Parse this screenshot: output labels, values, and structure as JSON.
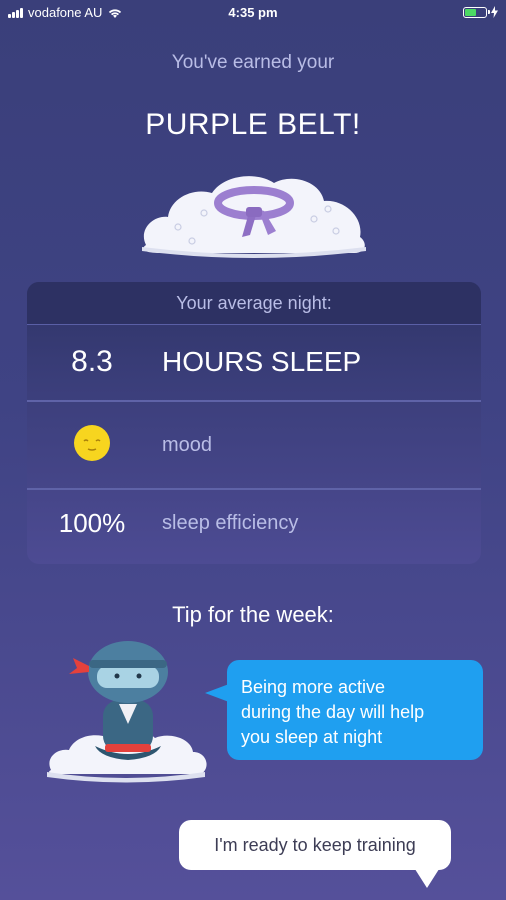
{
  "status_bar": {
    "carrier": "vodafone AU",
    "time": "4:35 pm",
    "battery_color": "#4cd964",
    "battery_level": 0.6
  },
  "header": {
    "subtitle": "You've earned your",
    "title": "PURPLE BELT!"
  },
  "stats": {
    "heading": "Your average night:",
    "rows": [
      {
        "value": "8.3",
        "label": "HOURS SLEEP"
      },
      {
        "icon": "smiley-icon",
        "label": "mood"
      },
      {
        "value": "100%",
        "label": "sleep efficiency"
      }
    ]
  },
  "tip": {
    "title": "Tip for the week:",
    "message_lines": [
      "Being more active",
      "during the day will help",
      "you sleep at night"
    ]
  },
  "reply": {
    "label": "I'm ready to keep training"
  },
  "colors": {
    "background": "#3f4384",
    "bubble": "#1f9ff0",
    "belt": "#9c7fd0",
    "smiley": "#f7d51f"
  }
}
